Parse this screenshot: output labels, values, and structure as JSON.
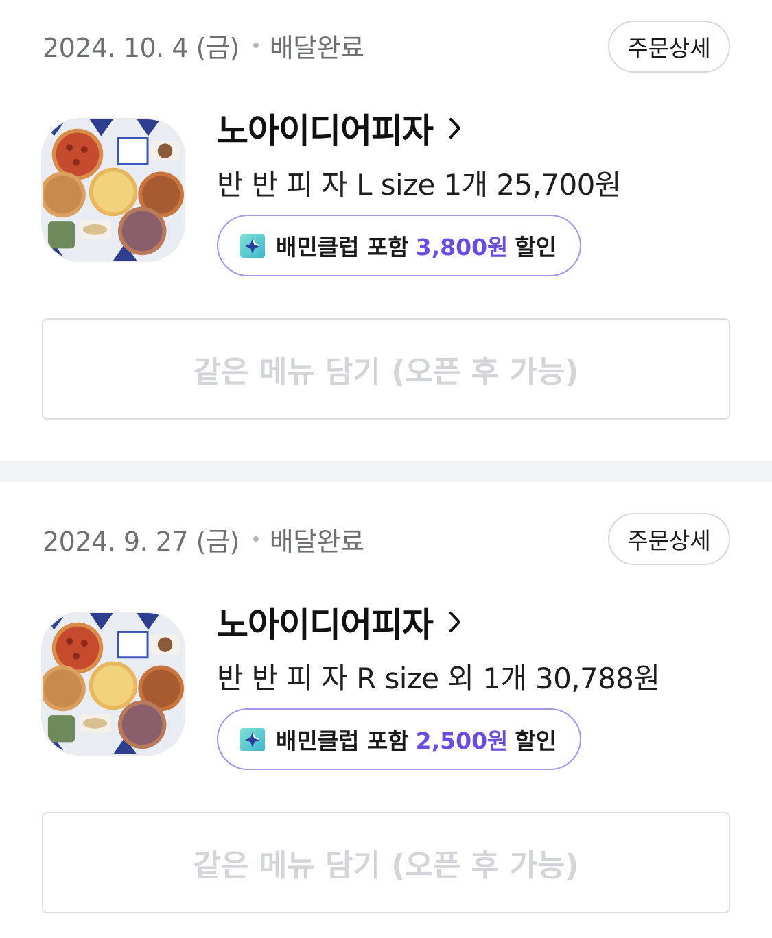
{
  "orders": [
    {
      "date": "2024. 10. 4 (금)",
      "status": "배달완료",
      "detail_label": "주문상세",
      "store_name": "노아이디어피자",
      "menu_summary": "반 반 피 자 L size 1개 25,700원",
      "club_prefix": "배민클럽 포함",
      "club_amount": "3,800원",
      "club_suffix": "할인",
      "reorder_label": "같은 메뉴 담기 (오픈 후 가능)"
    },
    {
      "date": "2024. 9. 27 (금)",
      "status": "배달완료",
      "detail_label": "주문상세",
      "store_name": "노아이디어피자",
      "menu_summary": "반 반 피 자 R size 외 1개 30,788원",
      "club_prefix": "배민클럽 포함",
      "club_amount": "2,500원",
      "club_suffix": "할인",
      "reorder_label": "같은 메뉴 담기 (오픈 후 가능)"
    }
  ],
  "icons": {
    "store_chevron": "chevron-right-icon",
    "club_badge": "sparkle-badge-icon",
    "store_thumbnail": "pizza-spread-image"
  },
  "colors": {
    "accent": "#6a4ce0",
    "club_border": "#a894e8",
    "divider": "#f3f4f5",
    "disabled_text": "#d3d5d8",
    "meta_text": "#6d6f72"
  }
}
